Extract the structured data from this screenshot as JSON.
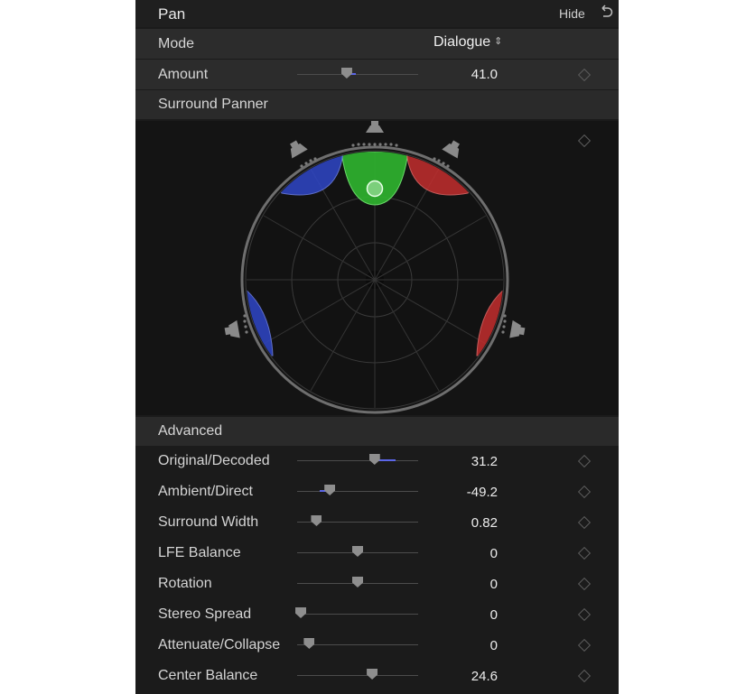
{
  "header": {
    "title": "Pan",
    "hide_label": "Hide"
  },
  "mode": {
    "label": "Mode",
    "value": "Dialogue"
  },
  "amount": {
    "label": "Amount",
    "value": "41.0",
    "slider_fraction": 0.41
  },
  "surround_panner": {
    "label": "Surround Panner"
  },
  "advanced": {
    "label": "Advanced",
    "params": [
      {
        "label": "Original/Decoded",
        "value": "31.2",
        "slider_fraction": 0.64,
        "fill_from": 0.64,
        "fill_to": 0.81
      },
      {
        "label": "Ambient/Direct",
        "value": "-49.2",
        "slider_fraction": 0.27,
        "fill_from": 0.19,
        "fill_to": 0.27
      },
      {
        "label": "Surround Width",
        "value": "0.82",
        "slider_fraction": 0.16
      },
      {
        "label": "LFE Balance",
        "value": "0",
        "slider_fraction": 0.5
      },
      {
        "label": "Rotation",
        "value": "0",
        "slider_fraction": 0.5
      },
      {
        "label": "Stereo Spread",
        "value": "0",
        "slider_fraction": 0.03
      },
      {
        "label": "Attenuate/Collapse",
        "value": "0",
        "slider_fraction": 0.1
      },
      {
        "label": "Center Balance",
        "value": "24.6",
        "slider_fraction": 0.62
      }
    ]
  },
  "colors": {
    "accent": "#5b66e8",
    "center_lobe": "#2fae2f",
    "left_lobe": "#2f47c8",
    "right_lobe": "#c42e2e"
  }
}
